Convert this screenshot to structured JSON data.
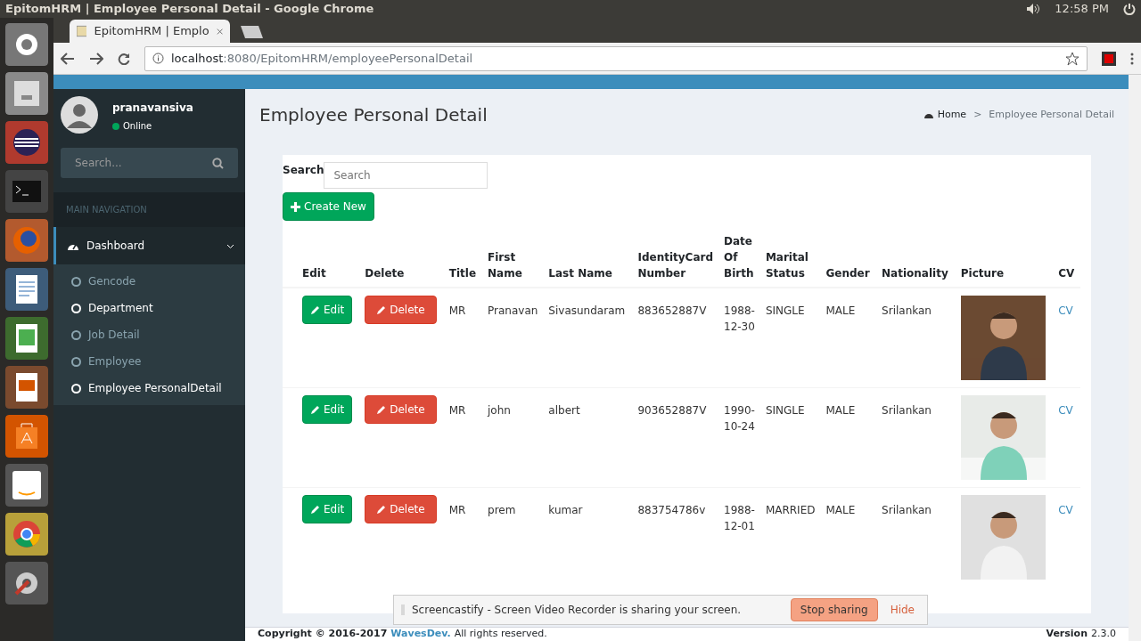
{
  "os": {
    "window_title": "EpitomHRM | Employee Personal Detail - Google Chrome",
    "clock": "12:58 PM"
  },
  "browser": {
    "tab_title": "EpitomHRM | Emplo",
    "url_host": "localhost",
    "url_path": ":8080/EpitomHRM/employeePersonalDetail"
  },
  "user": {
    "name": "pranavansiva",
    "status": "Online"
  },
  "sidebar": {
    "search_placeholder": "Search...",
    "section": "MAIN NAVIGATION",
    "menu": {
      "label": "Dashboard",
      "expanded": true,
      "children": [
        {
          "label": "Gencode",
          "active": false
        },
        {
          "label": "Department",
          "active": true
        },
        {
          "label": "Job Detail",
          "active": false
        },
        {
          "label": "Employee",
          "active": false
        },
        {
          "label": "Employee PersonalDetail",
          "active": true
        }
      ]
    }
  },
  "page": {
    "title": "Employee Personal Detail",
    "breadcrumb": [
      "Home",
      "Employee Personal Detail"
    ],
    "breadcrumb_separator": ">"
  },
  "search": {
    "label": "Search",
    "placeholder": "Search"
  },
  "create_button": "Create New",
  "table": {
    "columns": [
      "Edit",
      "Delete",
      "Title",
      "First Name",
      "Last Name",
      "IdentityCard Number",
      "Date Of Birth",
      "Marital Status",
      "Gender",
      "Nationality",
      "Picture",
      "CV"
    ],
    "rows": [
      [
        {
          "kind": "edit",
          "text": "Edit"
        },
        {
          "kind": "delete",
          "text": "Delete"
        },
        {
          "kind": "text",
          "text": "MR"
        },
        {
          "kind": "text",
          "text": "Pranavan"
        },
        {
          "kind": "text",
          "text": "Sivasundaram"
        },
        {
          "kind": "text",
          "text": "883652887V"
        },
        {
          "kind": "text",
          "text": "1988-12-30"
        },
        {
          "kind": "text",
          "text": "SINGLE"
        },
        {
          "kind": "text",
          "text": "MALE"
        },
        {
          "kind": "text",
          "text": "Srilankan"
        },
        {
          "kind": "picture"
        },
        {
          "kind": "link",
          "text": "CV"
        }
      ],
      [
        {
          "kind": "edit",
          "text": "Edit"
        },
        {
          "kind": "delete",
          "text": "Delete"
        },
        {
          "kind": "text",
          "text": "MR"
        },
        {
          "kind": "text",
          "text": "john"
        },
        {
          "kind": "text",
          "text": "albert"
        },
        {
          "kind": "text",
          "text": "903652887V"
        },
        {
          "kind": "text",
          "text": "1990-10-24"
        },
        {
          "kind": "text",
          "text": "SINGLE"
        },
        {
          "kind": "text",
          "text": "MALE"
        },
        {
          "kind": "text",
          "text": "Srilankan"
        },
        {
          "kind": "picture"
        },
        {
          "kind": "link",
          "text": "CV"
        }
      ],
      [
        {
          "kind": "edit",
          "text": "Edit"
        },
        {
          "kind": "delete",
          "text": "Delete"
        },
        {
          "kind": "text",
          "text": "MR"
        },
        {
          "kind": "text",
          "text": "prem"
        },
        {
          "kind": "text",
          "text": "kumar"
        },
        {
          "kind": "text",
          "text": "883754786v"
        },
        {
          "kind": "text",
          "text": "1988-12-01"
        },
        {
          "kind": "text",
          "text": "MARRIED"
        },
        {
          "kind": "text",
          "text": "MALE"
        },
        {
          "kind": "text",
          "text": "Srilankan"
        },
        {
          "kind": "picture"
        },
        {
          "kind": "link",
          "text": "CV"
        }
      ]
    ]
  },
  "footer": {
    "copyright": "Copyright © 2016-2017",
    "company": "WavesDev.",
    "rights": "All rights reserved.",
    "version_label": "Version",
    "version": "2.3.0"
  },
  "share_bar": {
    "message": "Screencastify - Screen Video Recorder is sharing your screen.",
    "stop_button": "Stop sharing",
    "hide_button": "Hide"
  }
}
